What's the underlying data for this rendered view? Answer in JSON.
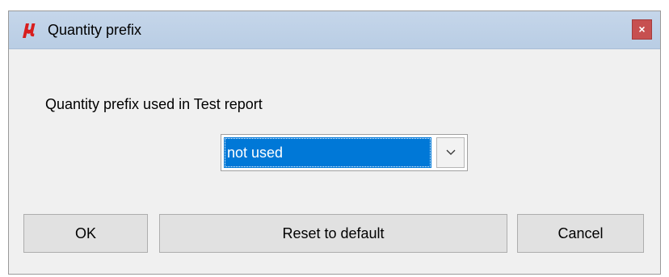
{
  "window": {
    "title": "Quantity prefix",
    "app_icon": "mu-logo-icon",
    "close_label": "×",
    "close_color": "#c75050",
    "title_bar_color": "#bfd2e8"
  },
  "content": {
    "prompt": "Quantity prefix used in Test report",
    "select": {
      "value": "not used",
      "selected_color": "#0078d7",
      "arrow_icon": "chevron-down-icon"
    }
  },
  "buttons": {
    "ok": "OK",
    "reset": "Reset to default",
    "cancel": "Cancel"
  }
}
